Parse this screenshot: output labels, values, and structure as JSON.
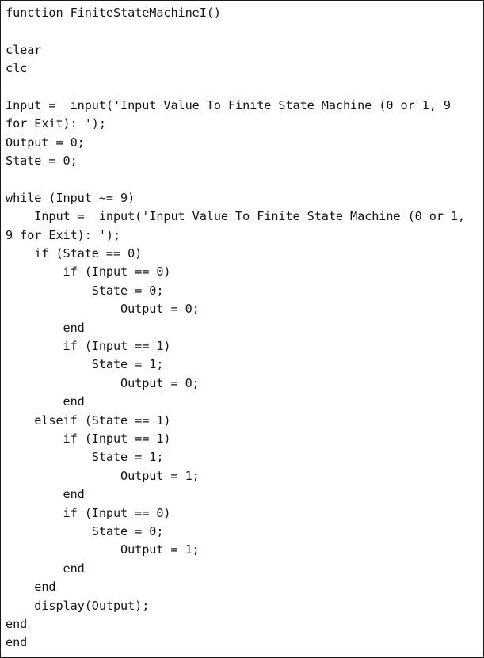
{
  "document": {
    "kind": "source-code-listing",
    "language": "MATLAB",
    "function_name": "FiniteStateMachineI",
    "border_color": "#1a1a1a",
    "background_color": "#ffffff",
    "text_color": "#14141e"
  },
  "code": {
    "lines": [
      "function FiniteStateMachineI()",
      "",
      "clear",
      "clc",
      "",
      "Input =  input('Input Value To Finite State Machine (0 or 1, 9",
      "for Exit): ');",
      "Output = 0;",
      "State = 0;",
      "",
      "while (Input ~= 9)",
      "    Input =  input('Input Value To Finite State Machine (0 or 1,",
      "9 for Exit): ');",
      "    if (State == 0)",
      "        if (Input == 0)",
      "            State = 0;",
      "                Output = 0;",
      "        end",
      "        if (Input == 1)",
      "            State = 1;",
      "                Output = 0;",
      "        end",
      "    elseif (State == 1)",
      "        if (Input == 1)",
      "            State = 1;",
      "                Output = 1;",
      "        end",
      "        if (Input == 0)",
      "            State = 0;",
      "                Output = 1;",
      "        end",
      "    end",
      "    display(Output);",
      "end",
      "end"
    ]
  }
}
